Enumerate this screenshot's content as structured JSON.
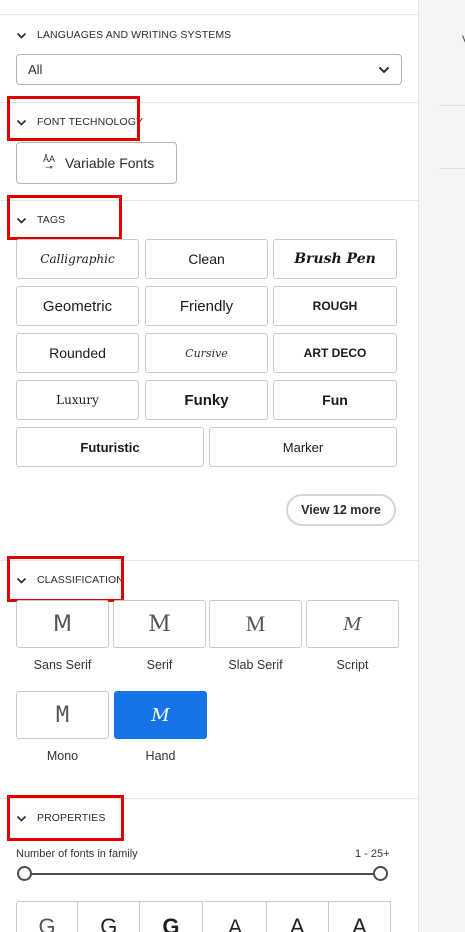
{
  "right_pane": {
    "letter": "V"
  },
  "languages": {
    "title": "LANGUAGES AND WRITING SYSTEMS",
    "selected_value": "All"
  },
  "font_technology": {
    "title": "FONT TECHNOLOGY",
    "icon_glyph": "ÅA",
    "button_label": "Variable Fonts"
  },
  "tags": {
    "title": "TAGS",
    "items": [
      {
        "label": "Calligraphic"
      },
      {
        "label": "Clean"
      },
      {
        "label": "Brush Pen"
      },
      {
        "label": "Geometric"
      },
      {
        "label": "Friendly"
      },
      {
        "label": "ROUGH"
      },
      {
        "label": "Rounded"
      },
      {
        "label": "Cursive"
      },
      {
        "label": "ART DECO"
      },
      {
        "label": "Luxury"
      },
      {
        "label": "Funky"
      },
      {
        "label": "Fun"
      },
      {
        "label": "Futuristic"
      },
      {
        "label": "Marker"
      }
    ],
    "view_more": "View 12 more"
  },
  "classification": {
    "title": "CLASSIFICATION",
    "items": [
      {
        "glyph": "M",
        "label": "Sans Serif",
        "selected": false
      },
      {
        "glyph": "M",
        "label": "Serif",
        "selected": false
      },
      {
        "glyph": "M",
        "label": "Slab Serif",
        "selected": false
      },
      {
        "glyph": "M",
        "label": "Script",
        "selected": false
      },
      {
        "glyph": "M",
        "label": "Mono",
        "selected": false
      },
      {
        "glyph": "M",
        "label": "Hand",
        "selected": true
      }
    ]
  },
  "properties": {
    "title": "PROPERTIES",
    "slider_label": "Number of fonts in family",
    "slider_range": "1 - 25+",
    "weights": [
      "G",
      "G",
      "G",
      "A",
      "A",
      "A"
    ]
  },
  "colors": {
    "accent": "#1473e6",
    "highlight": "#e00000"
  }
}
